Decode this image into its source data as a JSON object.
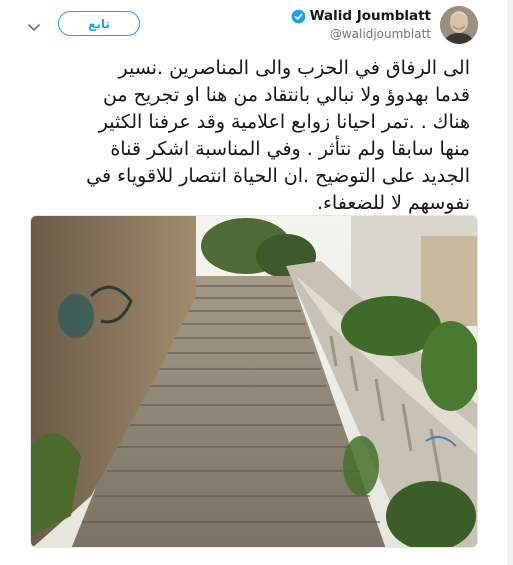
{
  "tweet": {
    "author": {
      "display_name": "Walid Joumblatt",
      "handle": "@walidjoumblatt",
      "verified": true,
      "avatar_icon": "avatar-portrait"
    },
    "follow_button_label": "تابع",
    "menu_icon": "chevron-down-icon",
    "text": "الى الرفاق في الحزب والى المناصرين .نسير\nقدما بهدوؤ ولا نبالي بانتقاد من هنا او تجريح من\nهناك . .تمر احيانا زوابع اعلامية وقد عرفنا الكثير\nمنها سابقا ولم نتأثر . وفي المناسبة اشكر قناة\nالجديد على التوضيح .ان الحياة انتصار للاقوياء في\nنفوسهم لا للضعفاء.",
    "photo": {
      "description_icon": "photo-stone-staircase"
    }
  },
  "colors": {
    "accent": "#1da1f2",
    "text": "#14171a",
    "secondary": "#657786"
  }
}
